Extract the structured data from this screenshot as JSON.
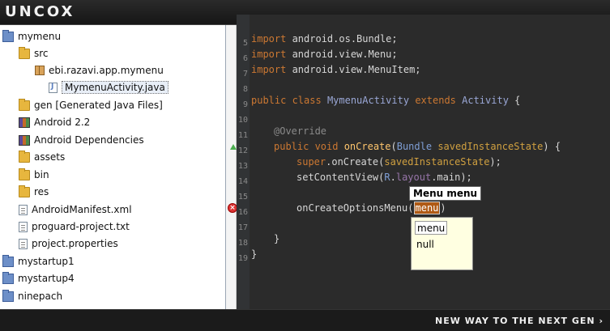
{
  "banner": {
    "logo": "UNCOX"
  },
  "explorer": {
    "items": [
      {
        "label": "mymenu",
        "icon": "project-icon"
      },
      {
        "label": "src",
        "icon": "folder-icon"
      },
      {
        "label": "ebi.razavi.app.mymenu",
        "icon": "package-icon"
      },
      {
        "label": "MymenuActivity.java",
        "icon": "java-file-icon",
        "selected": true
      },
      {
        "label": "gen [Generated Java Files]",
        "icon": "folder-icon"
      },
      {
        "label": "Android 2.2",
        "icon": "library-icon"
      },
      {
        "label": "Android Dependencies",
        "icon": "library-icon"
      },
      {
        "label": "assets",
        "icon": "folder-icon"
      },
      {
        "label": "bin",
        "icon": "folder-icon"
      },
      {
        "label": "res",
        "icon": "folder-icon"
      },
      {
        "label": "AndroidManifest.xml",
        "icon": "file-icon"
      },
      {
        "label": "proguard-project.txt",
        "icon": "file-icon"
      },
      {
        "label": "project.properties",
        "icon": "file-icon"
      },
      {
        "label": "mystartup1",
        "icon": "project-icon"
      },
      {
        "label": "mystartup4",
        "icon": "project-icon"
      },
      {
        "label": "ninepach",
        "icon": "project-icon"
      }
    ]
  },
  "editor": {
    "line_numbers": [
      "5",
      "6",
      "7",
      "8",
      "9",
      "10",
      "11",
      "12",
      "13",
      "14",
      "15",
      "16",
      "17",
      "18",
      "19"
    ],
    "lines": {
      "l5": {
        "a": "import ",
        "b": "android.os.Bundle;"
      },
      "l6": {
        "a": "import ",
        "b": "android.view.Menu;"
      },
      "l7": {
        "a": "import ",
        "b": "android.view.MenuItem;"
      },
      "l9": {
        "a": "public ",
        "b": "class ",
        "c": "MymenuActivity",
        "d": " extends ",
        "e": "Activity",
        "f": " {"
      },
      "l11": {
        "a": "@Override"
      },
      "l12": {
        "a": "public ",
        "b": "void ",
        "c": "onCreate",
        "d": "(",
        "e": "Bundle",
        "f": " savedInstanceState",
        "g": ") {"
      },
      "l13": {
        "a": "super",
        "b": ".onCreate(",
        "c": "savedInstanceState",
        "d": ");"
      },
      "l14": {
        "a": "setContentView(",
        "b": "R",
        "c": ".",
        "d": "layout",
        "e": ".main);"
      },
      "l16": {
        "a": "onCreateOptionsMenu(",
        "b": "menu",
        "c": ")"
      },
      "l18": {
        "a": "}"
      },
      "l19": {
        "a": "}"
      }
    },
    "tooltip": "Menu menu",
    "suggestions": [
      "menu",
      "null"
    ]
  },
  "footer": {
    "tagline": "New way to the next gen ›"
  }
}
